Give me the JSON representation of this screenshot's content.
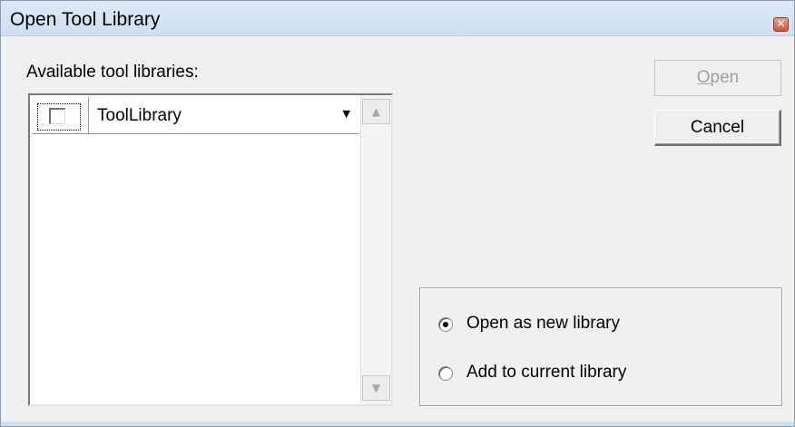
{
  "window": {
    "title": "Open Tool Library",
    "close_glyph": "✕"
  },
  "label": {
    "available": "Available tool libraries:"
  },
  "list": {
    "items": [
      {
        "label": "ToolLibrary",
        "checked": false,
        "dropdown_glyph": "▼"
      }
    ],
    "scroll_up_glyph": "▲",
    "scroll_down_glyph": "▼"
  },
  "buttons": {
    "open_mnemonic": "O",
    "open_rest": "pen",
    "open_enabled": false,
    "cancel": "Cancel"
  },
  "options": {
    "selected": "open_as_new",
    "open_as_new": "Open as new library",
    "add_to_current": "Add to current library"
  }
}
